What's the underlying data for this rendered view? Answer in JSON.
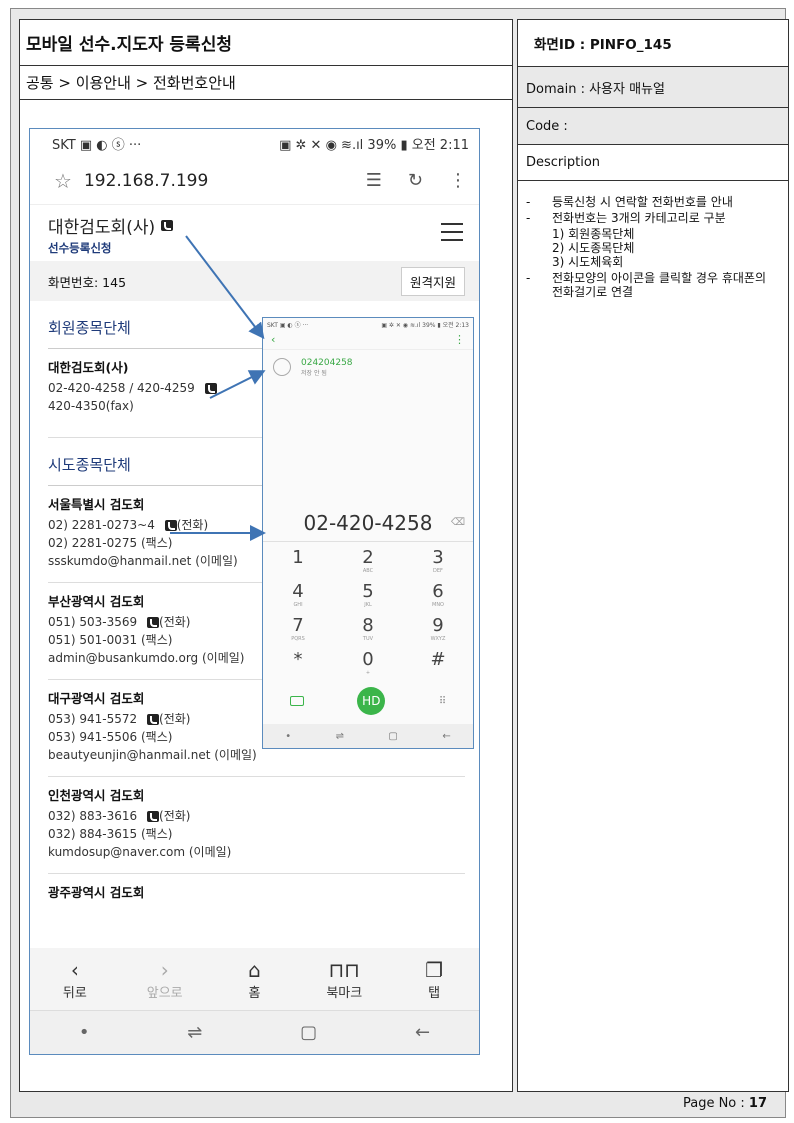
{
  "doc": {
    "title": "모바일 선수.지도자 등록신청",
    "breadcrumb": "공통 > 이용안내 > 전화번호안내",
    "screen_id": "화면ID : PINFO_145",
    "domain": "Domain : 사용자 매뉴얼",
    "code": "Code :",
    "description_label": "Description",
    "page_label": "Page No :",
    "page_number": "17"
  },
  "description": {
    "item1": "등록신청 시 연락할 전화번호를 안내",
    "item2": "전화번호는 3개의 카테고리로 구분",
    "sub1": "1) 회원종목단체",
    "sub2": "2) 시도종목단체",
    "sub3": "3) 시도체육회",
    "item3": "전화모양의 아이콘을 클릭할 경우 휴대폰의 전화걸기로 연결"
  },
  "phone": {
    "status_left": "SKT ▣ ◐ ⓢ ···",
    "status_right": "▣ ✲ ✕ ◉ ≋.ıl 39% ▮ 오전 2:11",
    "url": "192.168.7.199",
    "site_name": "대한검도회(사)",
    "site_sub": "선수등록신청",
    "screen_no": "화면번호: 145",
    "remote_btn": "원격지원",
    "cat1": "회원종목단체",
    "kendo_name": "대한검도회(사)",
    "kendo_tel": "02-420-4258 / 420-4259",
    "kendo_fax": "420-4350(fax)",
    "cat2": "시도종목단체",
    "seoul_name": "서울특별시 검도회",
    "seoul_tel": "02) 2281-0273~4",
    "seoul_tel_tag": "(전화)",
    "seoul_fax": "02) 2281-0275 (팩스)",
    "seoul_mail": "ssskumdo@hanmail.net (이메일)",
    "busan_name": "부산광역시 검도회",
    "busan_tel": "051) 503-3569",
    "busan_tel_tag": "(전화)",
    "busan_fax": "051) 501-0031 (팩스)",
    "busan_mail": "admin@busankumdo.org (이메일)",
    "daegu_name": "대구광역시 검도회",
    "daegu_tel": "053) 941-5572",
    "daegu_tel_tag": "(전화)",
    "daegu_fax": "053) 941-5506 (팩스)",
    "daegu_mail": "beautyeunjin@hanmail.net (이메일)",
    "incheon_name": "인천광역시 검도회",
    "incheon_tel": "032) 883-3616",
    "incheon_tel_tag": "(전화)",
    "incheon_fax": "032) 884-3615 (팩스)",
    "incheon_mail": "kumdosup@naver.com (이메일)",
    "gwangju_name": "광주광역시 검도회",
    "nav_back": "뒤로",
    "nav_forward": "앞으로",
    "nav_home": "홈",
    "nav_bookmark": "북마크",
    "nav_tab": "탭"
  },
  "dialer": {
    "status_left": "SKT ▣ ◐ ⓢ ···",
    "status_right": "▣ ✲ ✕ ◉ ≋.ıl 39% ▮ 오전 2:13",
    "recent_number": "024204258",
    "recent_sub": "저장 안 됨",
    "display": "02-420-4258",
    "call_label": "HD"
  },
  "icons": {
    "phone": "phone-icon",
    "star": "star-icon",
    "menu": "hamburger-menu-icon"
  }
}
